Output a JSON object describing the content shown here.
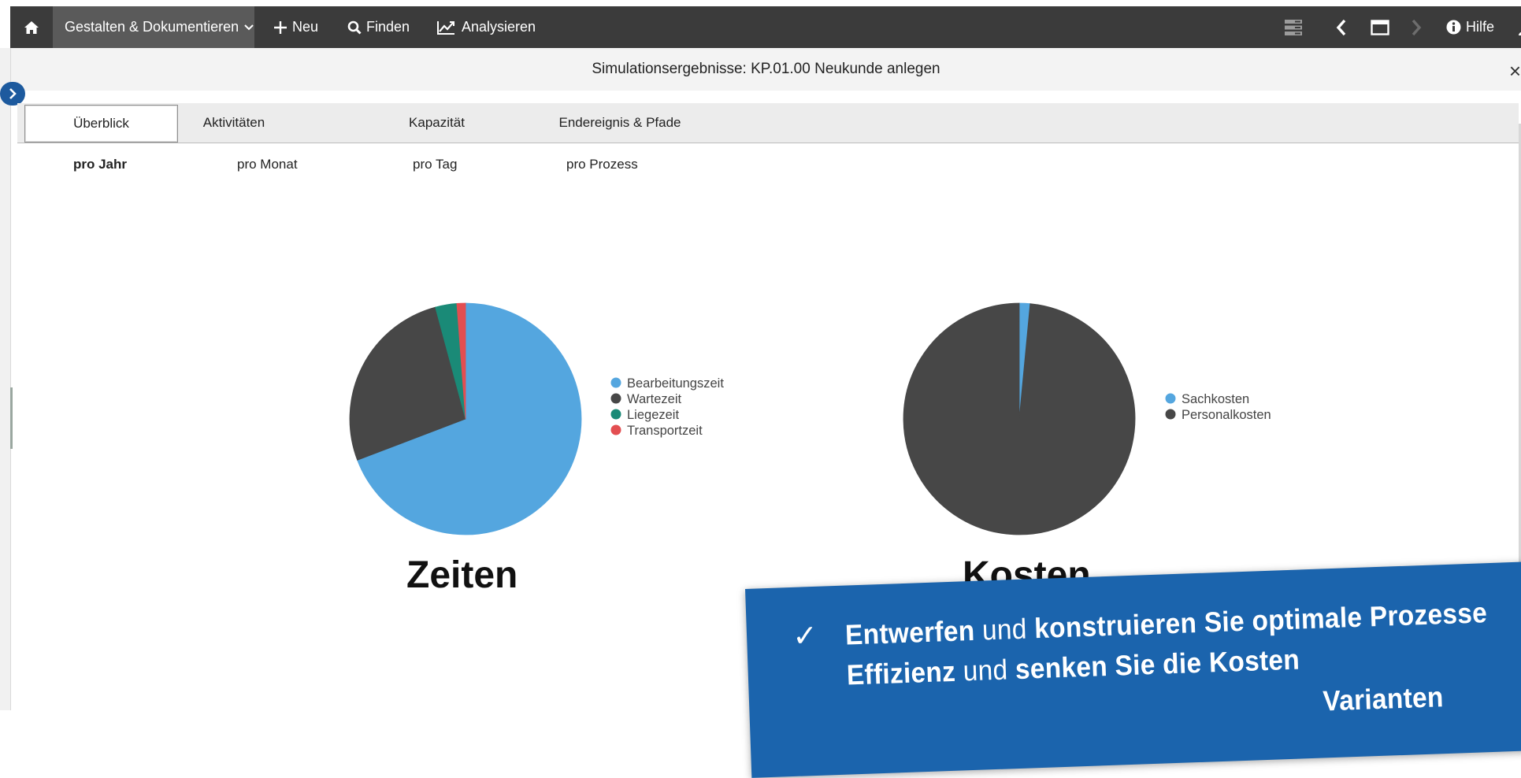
{
  "nav": {
    "design_label": "Gestalten & Dokumentieren",
    "new_label": "Neu",
    "find_label": "Finden",
    "analyze_label": "Analysieren",
    "help_label": "Hilfe"
  },
  "dialog": {
    "title": "Simulationsergebnisse: KP.01.00 Neukunde anlegen",
    "close": "×"
  },
  "tabs": [
    {
      "label": "Überblick",
      "active": true
    },
    {
      "label": "Aktivitäten",
      "active": false
    },
    {
      "label": "Kapazität",
      "active": false
    },
    {
      "label": "Endereignis & Pfade",
      "active": false
    }
  ],
  "subtabs": [
    {
      "label": "pro Jahr",
      "active": true
    },
    {
      "label": "pro Monat",
      "active": false
    },
    {
      "label": "pro Tag",
      "active": false
    },
    {
      "label": "pro Prozess",
      "active": false
    }
  ],
  "chart_data": [
    {
      "type": "pie",
      "title": "Zeiten",
      "categories": [
        "Bearbeitungszeit",
        "Wartezeit",
        "Liegezeit",
        "Transportzeit"
      ],
      "values": [
        69.2,
        26.6,
        3.0,
        1.2
      ],
      "colors": [
        "#54a6df",
        "#474747",
        "#1a8a77",
        "#e34e51"
      ],
      "legend": "right"
    },
    {
      "type": "pie",
      "title": "Kosten",
      "categories": [
        "Sachkosten",
        "Personalkosten"
      ],
      "values": [
        1.5,
        98.5
      ],
      "colors": [
        "#54a6df",
        "#474747"
      ],
      "legend": "right"
    }
  ],
  "banner": {
    "check": "✓",
    "line1_a": "Entwerfen",
    "line1_b": " und ",
    "line1_c": "konstruieren Sie optimale Prozesse",
    "line2_a": "Effizienz",
    "line2_b": " und ",
    "line2_c": "senken Sie die Kosten",
    "line3": "Varianten"
  },
  "colors": {
    "nav_bg": "#3b3b3b",
    "nav_active": "#5a5a5a",
    "banner_bg": "#1b64ad",
    "accent_blue": "#1d5a9e"
  }
}
